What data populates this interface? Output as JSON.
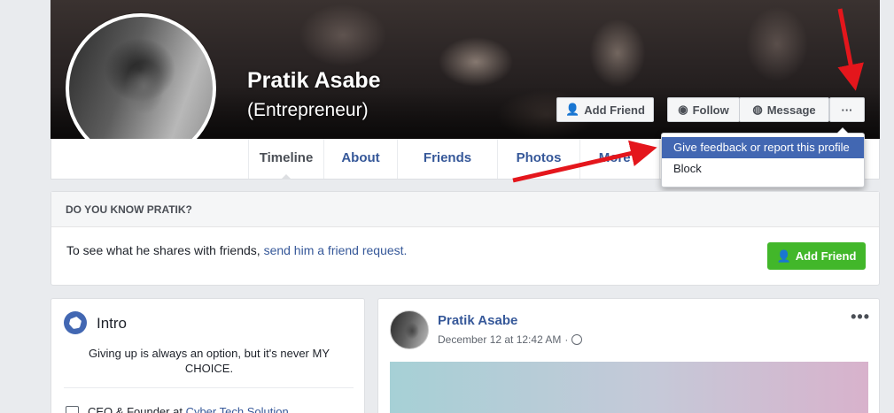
{
  "profile": {
    "name": "Pratik Asabe",
    "subtitle": "(Entrepreneur)"
  },
  "cover_actions": {
    "add_friend": "Add Friend",
    "follow": "Follow",
    "message": "Message",
    "more": "···"
  },
  "nav": {
    "tabs": [
      "Timeline",
      "About",
      "Friends",
      "Photos",
      "More ▾"
    ]
  },
  "dropdown": {
    "items": [
      "Give feedback or report this profile",
      "Block"
    ]
  },
  "know": {
    "header": "DO YOU KNOW PRATIK?",
    "text": "To see what he shares with friends, ",
    "link": "send him a friend request.",
    "button": "Add Friend"
  },
  "intro": {
    "title": "Intro",
    "bio": "Giving up is always an option, but it's never MY CHOICE.",
    "job_prefix": "CEO & Founder at ",
    "job_company": "Cyber Tech Solution"
  },
  "post": {
    "author": "Pratik Asabe",
    "time": "December 12 at 12:42 AM",
    "separator": "·",
    "more": "•••"
  },
  "colors": {
    "link": "#365899",
    "accent": "#4267b2",
    "green": "#42b72a",
    "arrow": "#e4161c"
  }
}
